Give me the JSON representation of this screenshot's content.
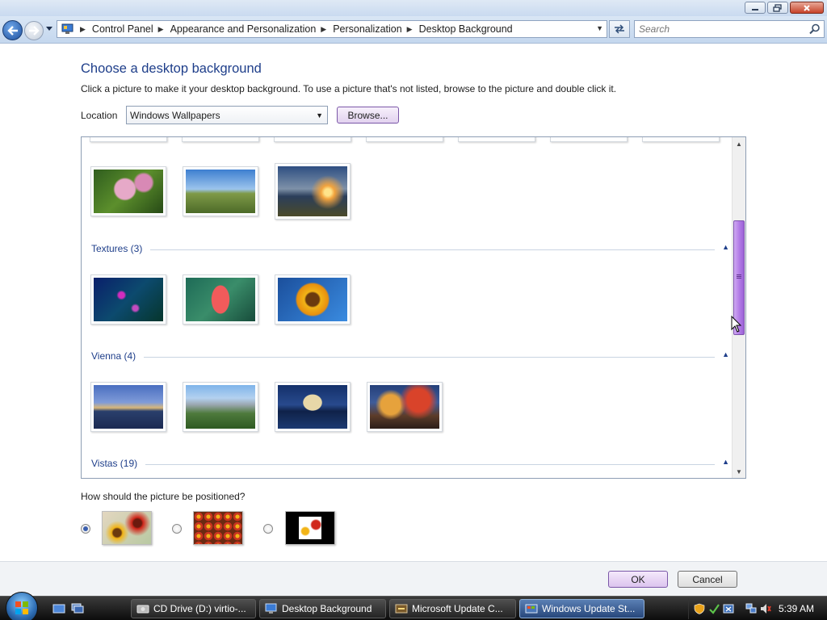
{
  "window": {
    "titlebar_buttons": [
      "minimize-icon",
      "maximize-icon",
      "close-icon"
    ]
  },
  "address_bar": {
    "breadcrumbs": [
      "Control Panel",
      "Appearance and Personalization",
      "Personalization",
      "Desktop Background"
    ],
    "search_placeholder": "Search"
  },
  "page": {
    "title": "Choose a desktop background",
    "description": "Click a picture to make it your desktop background. To use a picture that's not listed, browse to the picture and double click it.",
    "location_label": "Location",
    "location_value": "Windows Wallpapers",
    "browse_label": "Browse..."
  },
  "gallery": {
    "groups": [
      {
        "label": "Textures (3)"
      },
      {
        "label": "Vienna (4)"
      },
      {
        "label": "Vistas (19)"
      }
    ],
    "scroll_position": 0.46
  },
  "positioning": {
    "question": "How should the picture be positioned?",
    "options": [
      "fill-screen",
      "tile",
      "center"
    ],
    "selected_index": 0
  },
  "footer": {
    "ok_label": "OK",
    "cancel_label": "Cancel"
  },
  "taskbar": {
    "tasks": [
      {
        "label": "CD Drive (D:) virtio-...",
        "icon": "cd-drive-icon"
      },
      {
        "label": "Desktop Background",
        "icon": "control-panel-icon"
      },
      {
        "label": "Microsoft Update C...",
        "icon": "update-icon"
      },
      {
        "label": "Windows Update St...",
        "icon": "windows-update-icon",
        "active": true
      }
    ],
    "clock": "5:39 AM"
  },
  "colors": {
    "accent_purple": "#b27ae6",
    "heading_blue": "#1e3e8a",
    "address_bar_bg": "#c4d7ee",
    "taskbar_bg": "#0c0c0c"
  }
}
